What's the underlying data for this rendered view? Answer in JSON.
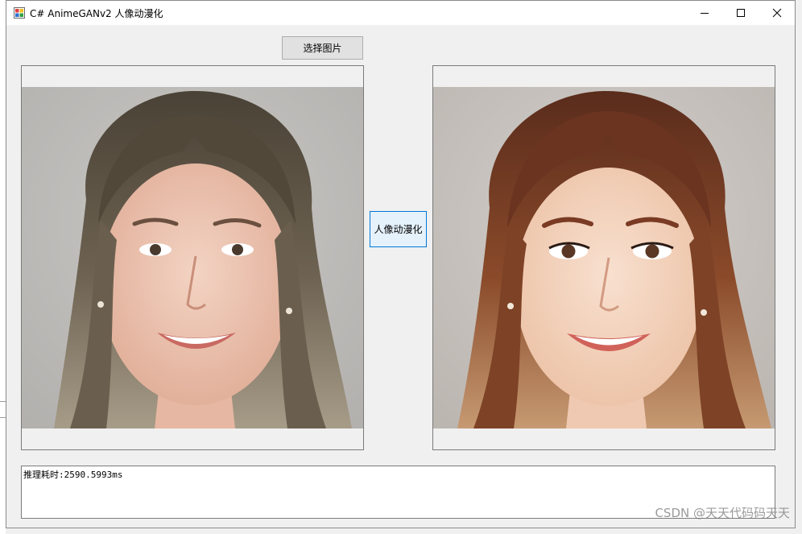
{
  "window": {
    "title": "C# AnimeGANv2 人像动漫化"
  },
  "controls": {
    "minimize_icon": "minimize-icon",
    "maximize_icon": "maximize-icon",
    "close_icon": "close-icon"
  },
  "buttons": {
    "select_image": "选择图片",
    "animate": "人像动漫化"
  },
  "images": {
    "source_icon": "portrait-photo",
    "result_icon": "anime-portrait"
  },
  "output": {
    "text": "推理耗时:2590.5993ms"
  },
  "watermark": "CSDN @天天代码码天天",
  "colors": {
    "focus_border": "#0078d7",
    "button_bg": "#e1e1e1",
    "window_bg": "#f0f0f0"
  }
}
